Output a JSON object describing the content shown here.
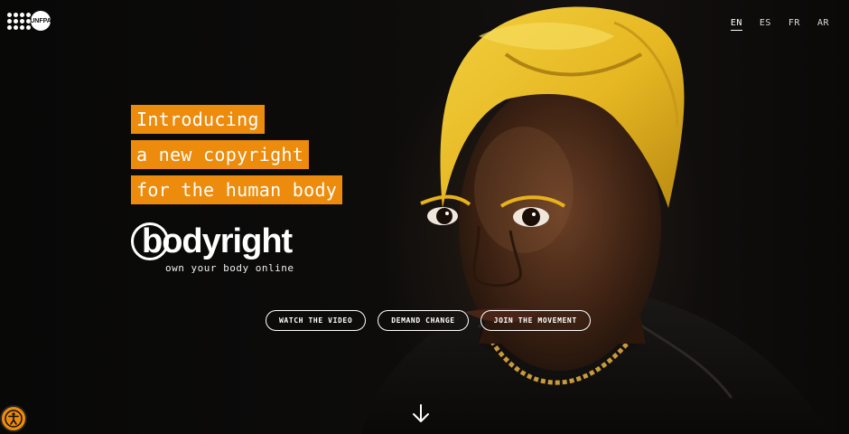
{
  "brand": {
    "org_logo_text": "UNFPA",
    "product_name": "bodyright",
    "tagline": "own your body online"
  },
  "languages": [
    {
      "code": "EN",
      "active": true
    },
    {
      "code": "ES",
      "active": false
    },
    {
      "code": "FR",
      "active": false
    },
    {
      "code": "AR",
      "active": false
    }
  ],
  "headline": {
    "lines": [
      "Introducing",
      "a new copyright",
      "for the human body"
    ]
  },
  "cta": {
    "watch_video": "WATCH THE VIDEO",
    "demand_change": "DEMAND CHANGE",
    "join_movement": "JOIN THE MOVEMENT"
  },
  "icons": {
    "scroll": "arrow-down-icon",
    "accessibility": "accessibility-icon"
  },
  "colors": {
    "accent": "#ec8b0c",
    "background": "#0b0a09",
    "text": "#ffffff"
  }
}
